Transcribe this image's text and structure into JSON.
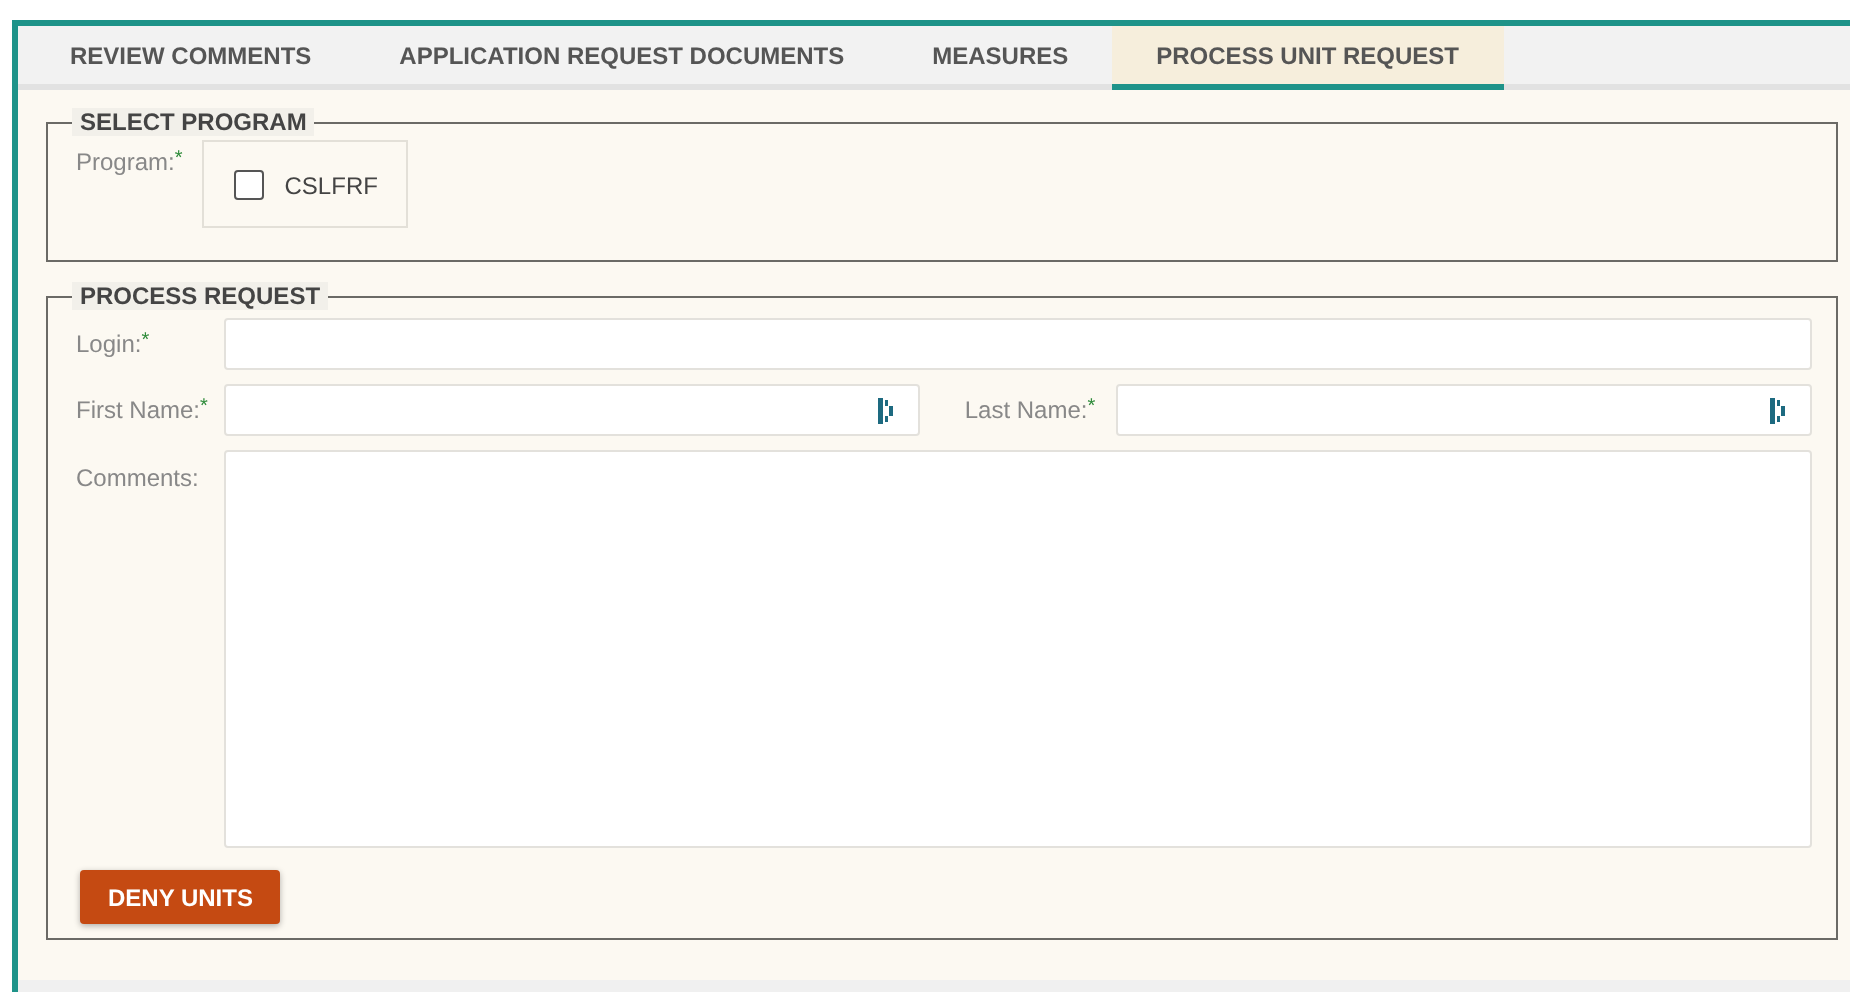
{
  "tabs": [
    {
      "label": "REVIEW COMMENTS",
      "selected": false
    },
    {
      "label": "APPLICATION REQUEST DOCUMENTS",
      "selected": false
    },
    {
      "label": "MEASURES",
      "selected": false
    },
    {
      "label": "PROCESS UNIT REQUEST",
      "selected": true
    }
  ],
  "select_program": {
    "legend": "SELECT PROGRAM",
    "label": "Program:",
    "required_mark": "*",
    "options": [
      {
        "label": "CSLFRF",
        "checked": false
      }
    ]
  },
  "process_request": {
    "legend": "PROCESS REQUEST",
    "login": {
      "label": "Login:",
      "required_mark": "*"
    },
    "first_name": {
      "label": "First Name:",
      "required_mark": "*"
    },
    "last_name": {
      "label": "Last Name:",
      "required_mark": "*"
    },
    "comments": {
      "label": "Comments:"
    },
    "deny_button": "DENY UNITS"
  }
}
